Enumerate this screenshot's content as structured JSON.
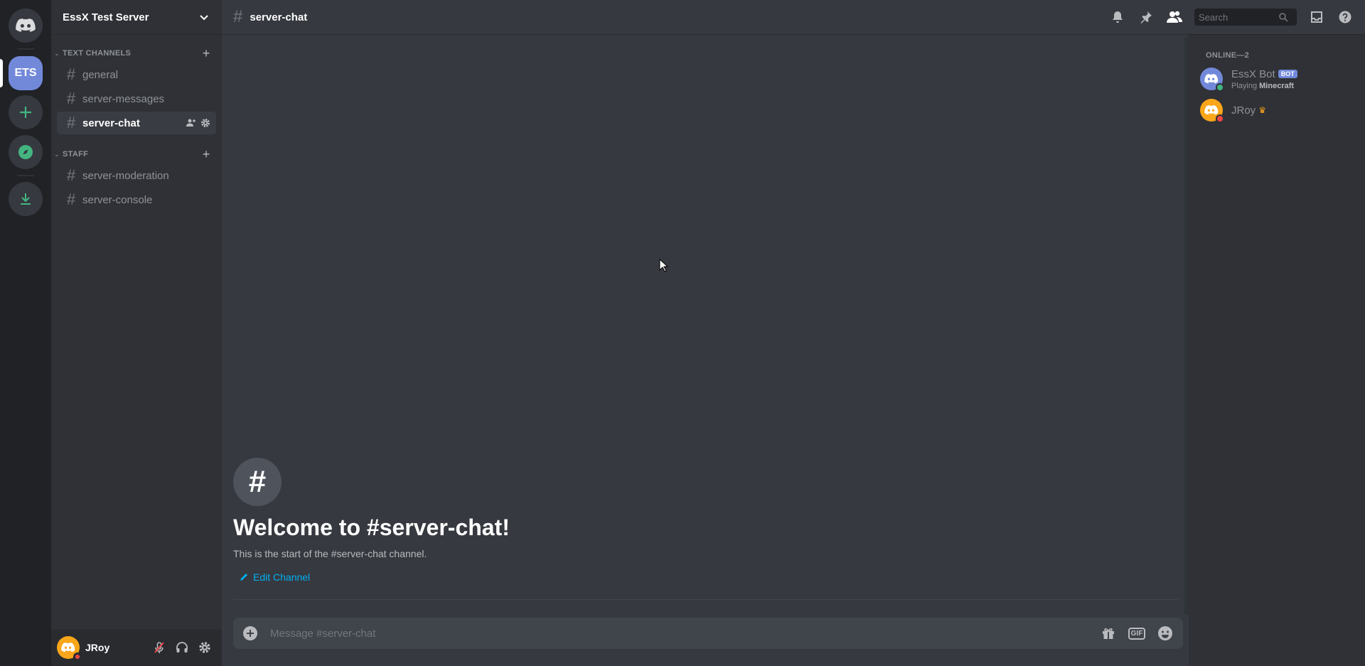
{
  "guild_rail": {
    "selected_guild_abbrev": "ETS"
  },
  "sidebar": {
    "server_name": "EssX Test Server",
    "categories": [
      {
        "label": "TEXT CHANNELS",
        "channels": [
          "general",
          "server-messages",
          "server-chat"
        ]
      },
      {
        "label": "STAFF",
        "channels": [
          "server-moderation",
          "server-console"
        ]
      }
    ],
    "active_channel": "server-chat"
  },
  "user_panel": {
    "username": "JRoy"
  },
  "topbar": {
    "channel_name": "server-chat",
    "search_placeholder": "Search"
  },
  "welcome": {
    "title": "Welcome to #server-chat!",
    "subtitle": "This is the start of the #server-chat channel.",
    "edit_label": "Edit Channel"
  },
  "composer": {
    "placeholder": "Message #server-chat",
    "gif_label": "GIF"
  },
  "members": {
    "header": "ONLINE—2",
    "list": [
      {
        "name": "EssX Bot",
        "tag": "BOT",
        "activity_prefix": "Playing",
        "activity_game": "Minecraft",
        "status_color": "#43b581"
      },
      {
        "name": "JRoy",
        "status_color": "#f04747"
      }
    ]
  },
  "colors": {
    "accent": "#7289da",
    "link": "#00b0f4",
    "online": "#43b581",
    "dnd": "#f04747",
    "avatar_yellow": "#faa61a"
  }
}
